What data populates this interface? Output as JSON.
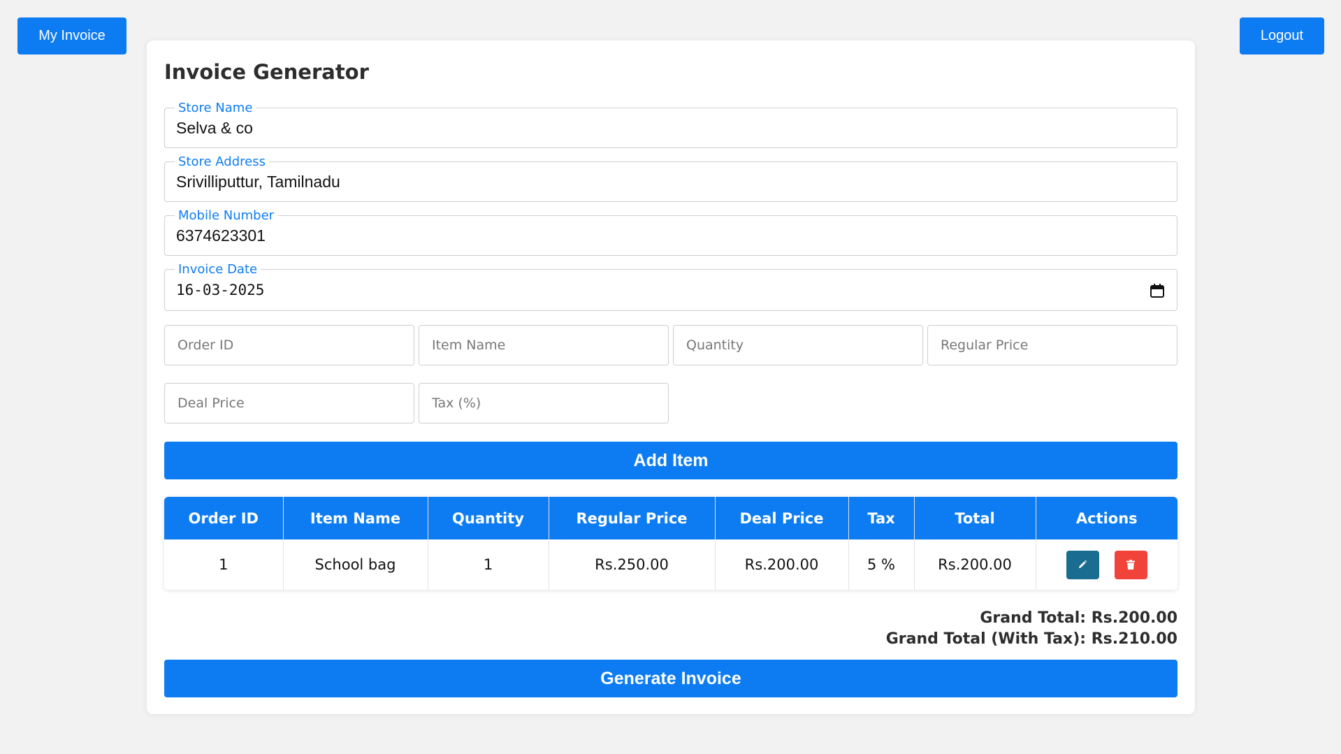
{
  "header": {
    "my_invoice_label": "My Invoice",
    "logout_label": "Logout"
  },
  "form": {
    "title": "Invoice Generator",
    "store_name": {
      "label": "Store Name",
      "value": "Selva & co"
    },
    "store_address": {
      "label": "Store Address",
      "value": "Srivilliputtur, Tamilnadu"
    },
    "mobile_number": {
      "label": "Mobile Number",
      "value": "6374623301"
    },
    "invoice_date": {
      "label": "Invoice Date",
      "value": "16-03-2025",
      "icon": "calendar-icon"
    },
    "item_inputs": {
      "order_id_placeholder": "Order ID",
      "item_name_placeholder": "Item Name",
      "quantity_placeholder": "Quantity",
      "regular_price_placeholder": "Regular Price",
      "deal_price_placeholder": "Deal Price",
      "tax_placeholder": "Tax (%)"
    },
    "add_item_label": "Add Item"
  },
  "table": {
    "headers": [
      "Order ID",
      "Item Name",
      "Quantity",
      "Regular Price",
      "Deal Price",
      "Tax",
      "Total",
      "Actions"
    ],
    "rows": [
      {
        "order_id": "1",
        "item_name": "School bag",
        "quantity": "1",
        "regular_price": "Rs.250.00",
        "deal_price": "Rs.200.00",
        "tax": "5 %",
        "total": "Rs.200.00",
        "actions": [
          "pencil-icon",
          "trash-icon"
        ]
      }
    ]
  },
  "totals": {
    "grand_total": "Grand Total: Rs.200.00",
    "grand_total_with_tax": "Grand Total (With Tax): Rs.210.00"
  },
  "generate_label": "Generate Invoice",
  "colors": {
    "primary": "#0d7cf2",
    "edit": "#1a6d91",
    "delete": "#f1433a",
    "background": "#f2f2f2"
  }
}
